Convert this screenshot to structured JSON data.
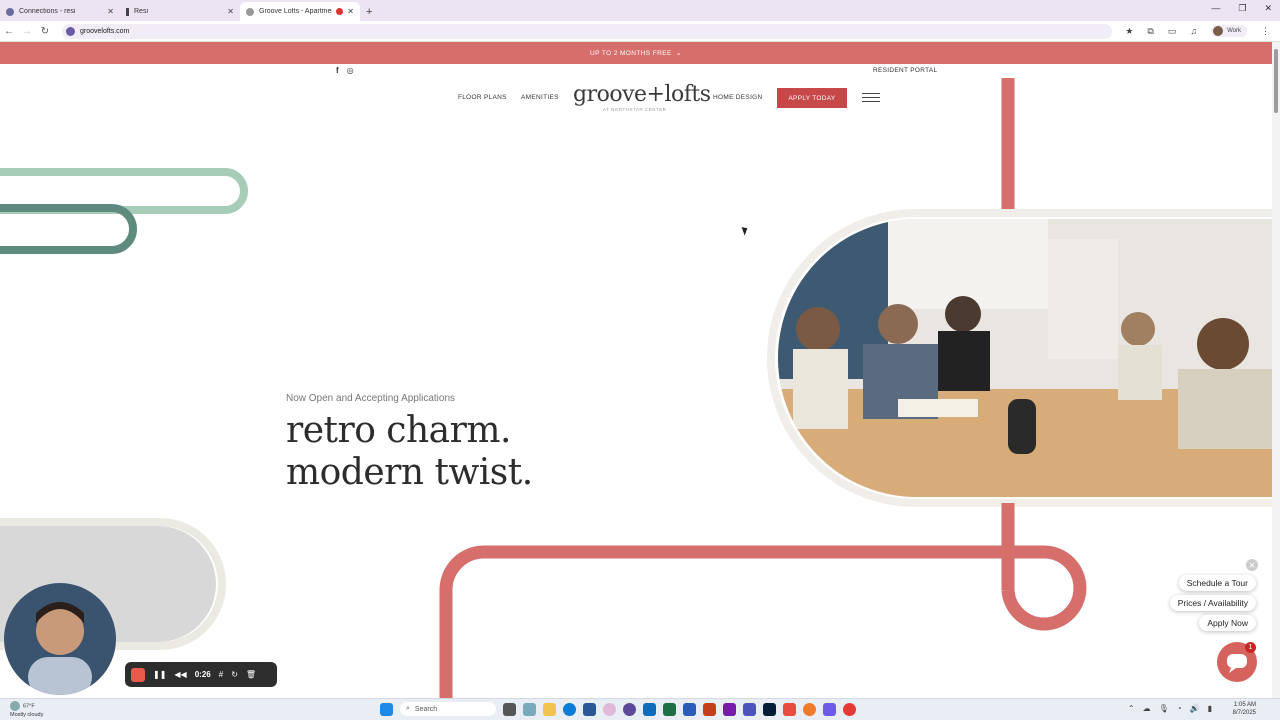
{
  "browser": {
    "tabs": [
      {
        "title": "Connections - resi"
      },
      {
        "title": "Resi"
      },
      {
        "title": "Groove Lofts - Apartments"
      }
    ],
    "url": "groovelofts.com",
    "profile_label": "Work"
  },
  "site": {
    "promo_text": "UP TO 2 MONTHS FREE",
    "resident_portal": "RESIDENT PORTAL",
    "nav": {
      "floor_plans": "FLOOR PLANS",
      "amenities": "AMENITIES",
      "logo": "groove+lofts",
      "logo_sub": "AT NORTHSTAR CENTER",
      "home_design": "HOME DESIGN",
      "apply": "APPLY TODAY"
    },
    "hero": {
      "eyebrow": "Now Open and Accepting Applications",
      "line1": "retro charm.",
      "line2": "modern twist."
    },
    "widgets": {
      "schedule": "Schedule a Tour",
      "prices": "Prices / Availability",
      "apply_now": "Apply Now",
      "chat_count": "1"
    },
    "colors": {
      "coral": "#d66e6b",
      "mint": "#a7cdb8",
      "teal": "#5e8a7f",
      "apply_red": "#c64848"
    }
  },
  "recorder": {
    "time": "0:26"
  },
  "taskbar": {
    "weather_temp": "67°F",
    "weather_desc": "Mostly cloudy",
    "search_placeholder": "Search",
    "time": "1:05 AM",
    "date": "8/7/2025"
  }
}
